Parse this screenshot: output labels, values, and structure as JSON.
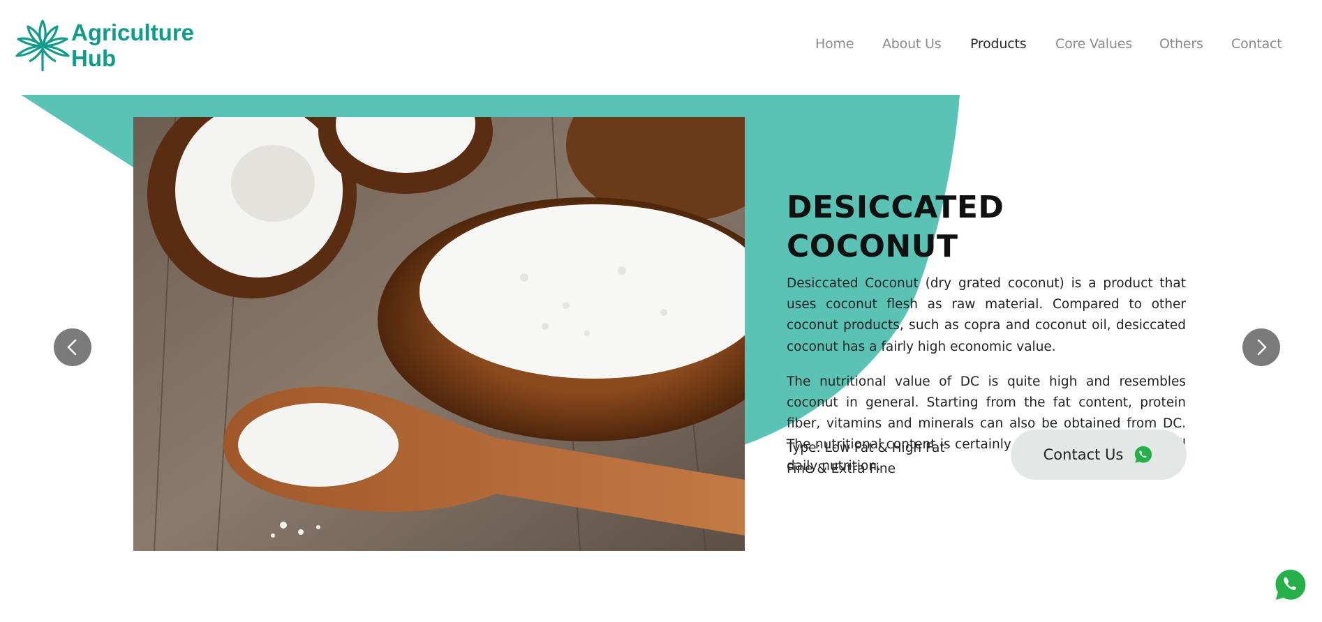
{
  "brand": {
    "line1": "Agriculture",
    "line2": "Hub",
    "color": "#119b8a"
  },
  "nav": {
    "items": [
      {
        "label": "Home",
        "active": false
      },
      {
        "label": "About Us",
        "active": false
      },
      {
        "label": "Products",
        "active": true
      },
      {
        "label": "Core Values",
        "active": false
      },
      {
        "label": "Others",
        "active": false
      },
      {
        "label": "Contact",
        "active": false
      }
    ]
  },
  "accent_color": "#5bc3b5",
  "product": {
    "title": "DESICCATED COCONUT",
    "paragraphs": [
      "Desiccated Coconut (dry grated coconut) is a product that uses coconut flesh as raw material. Compared to other coconut products, such as copra and coconut oil, desiccated coconut has a fairly high economic value.",
      "The nutritional value of DC is quite high and resembles coconut in general. Starting from the fat content, protein fiber, vitamins and minerals can also be obtained from DC. The nutritional content is certainly good for the body to fulfill daily nutrition."
    ],
    "type_line1": "Type: Low Fat & High Fat",
    "type_line2": "Fine & Extra Fine",
    "contact_label": "Contact Us"
  },
  "icons": {
    "prev": "chevron-left-icon",
    "next": "chevron-right-icon",
    "whatsapp": "whatsapp-icon",
    "logo": "leaf-burst-icon"
  }
}
